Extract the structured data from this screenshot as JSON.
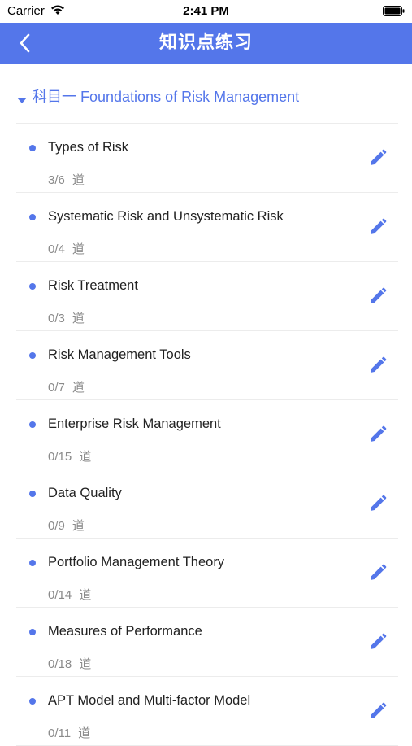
{
  "status_bar": {
    "carrier": "Carrier",
    "time": "2:41 PM"
  },
  "nav": {
    "title": "知识点练习",
    "back_icon": "chevron-left-icon"
  },
  "section": {
    "title": "科目一 Foundations of Risk Management",
    "expanded": true
  },
  "colors": {
    "accent": "#5476ea",
    "text": "#222222",
    "muted": "#8a8a8a"
  },
  "count_unit": "道",
  "topics": [
    {
      "name": "Types of Risk",
      "count": "3/6"
    },
    {
      "name": "Systematic Risk and Unsystematic Risk",
      "count": "0/4"
    },
    {
      "name": "Risk Treatment",
      "count": "0/3"
    },
    {
      "name": "Risk Management Tools",
      "count": "0/7"
    },
    {
      "name": "Enterprise Risk Management",
      "count": "0/15"
    },
    {
      "name": "Data Quality",
      "count": "0/9"
    },
    {
      "name": "Portfolio Management Theory",
      "count": "0/14"
    },
    {
      "name": "Measures of Performance",
      "count": "0/18"
    },
    {
      "name": "APT Model and Multi-factor Model",
      "count": "0/11"
    }
  ]
}
